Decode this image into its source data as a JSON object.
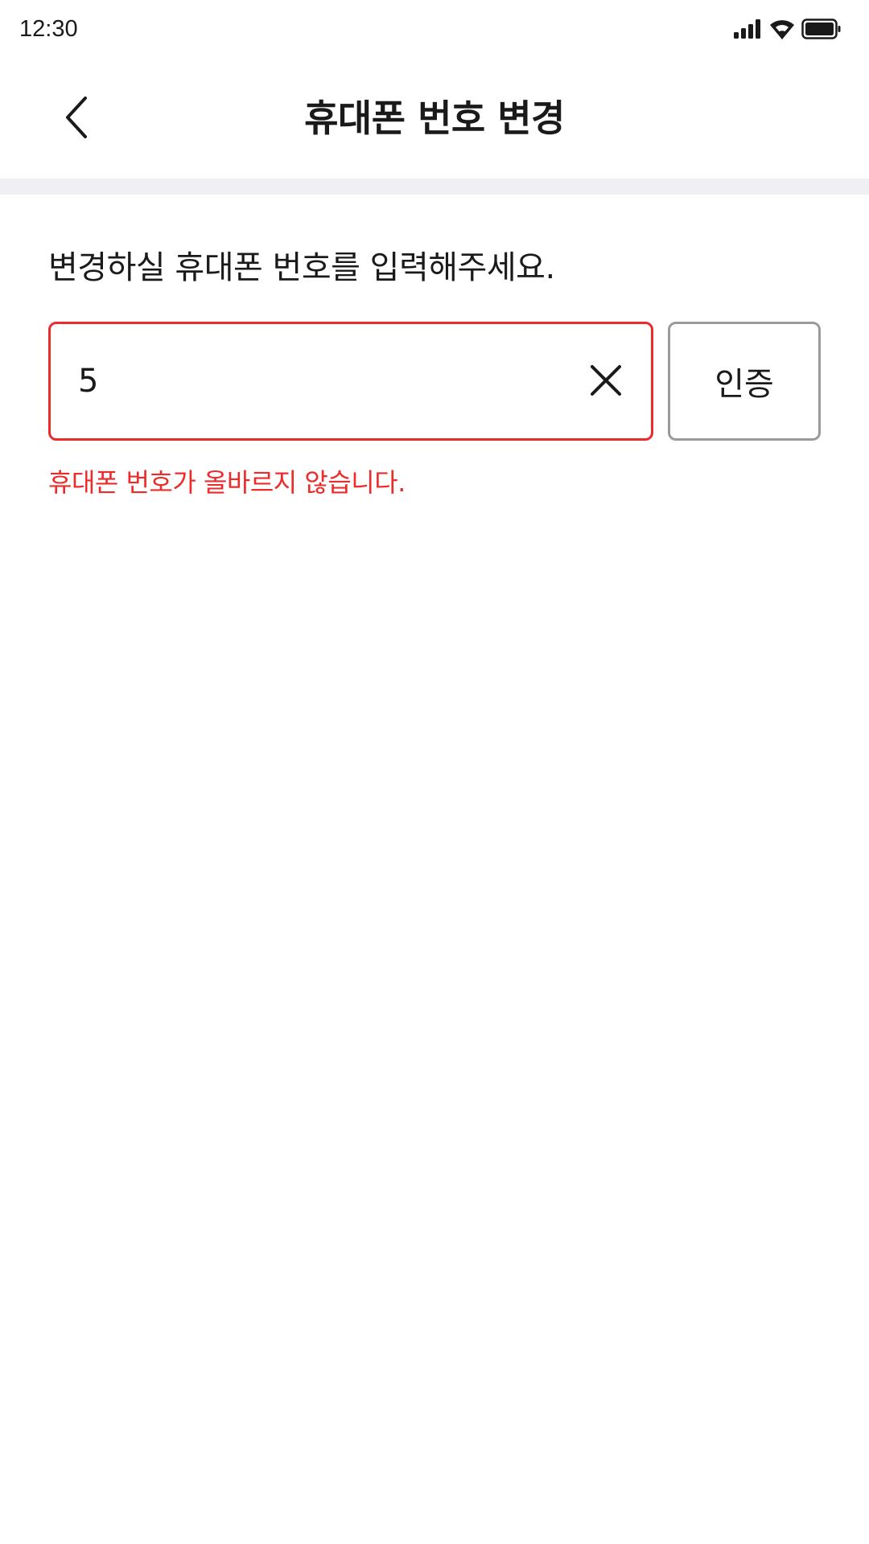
{
  "status_bar": {
    "time": "12:30",
    "icons": [
      "signal-icon",
      "wifi-icon",
      "battery-icon"
    ]
  },
  "header": {
    "title": "휴대폰 번호 변경",
    "back_icon": "chevron-left-icon"
  },
  "form": {
    "instruction": "변경하실 휴대폰 번호를 입력해주세요.",
    "phone_value": "5",
    "clear_icon": "close-icon",
    "verify_label": "인증",
    "error_message": "휴대폰 번호가 올바르지 않습니다."
  },
  "colors": {
    "error": "#ec2b2b",
    "divider": "#f0f0f4",
    "button_border": "#9a9a9a",
    "text": "#1a1a1a"
  }
}
